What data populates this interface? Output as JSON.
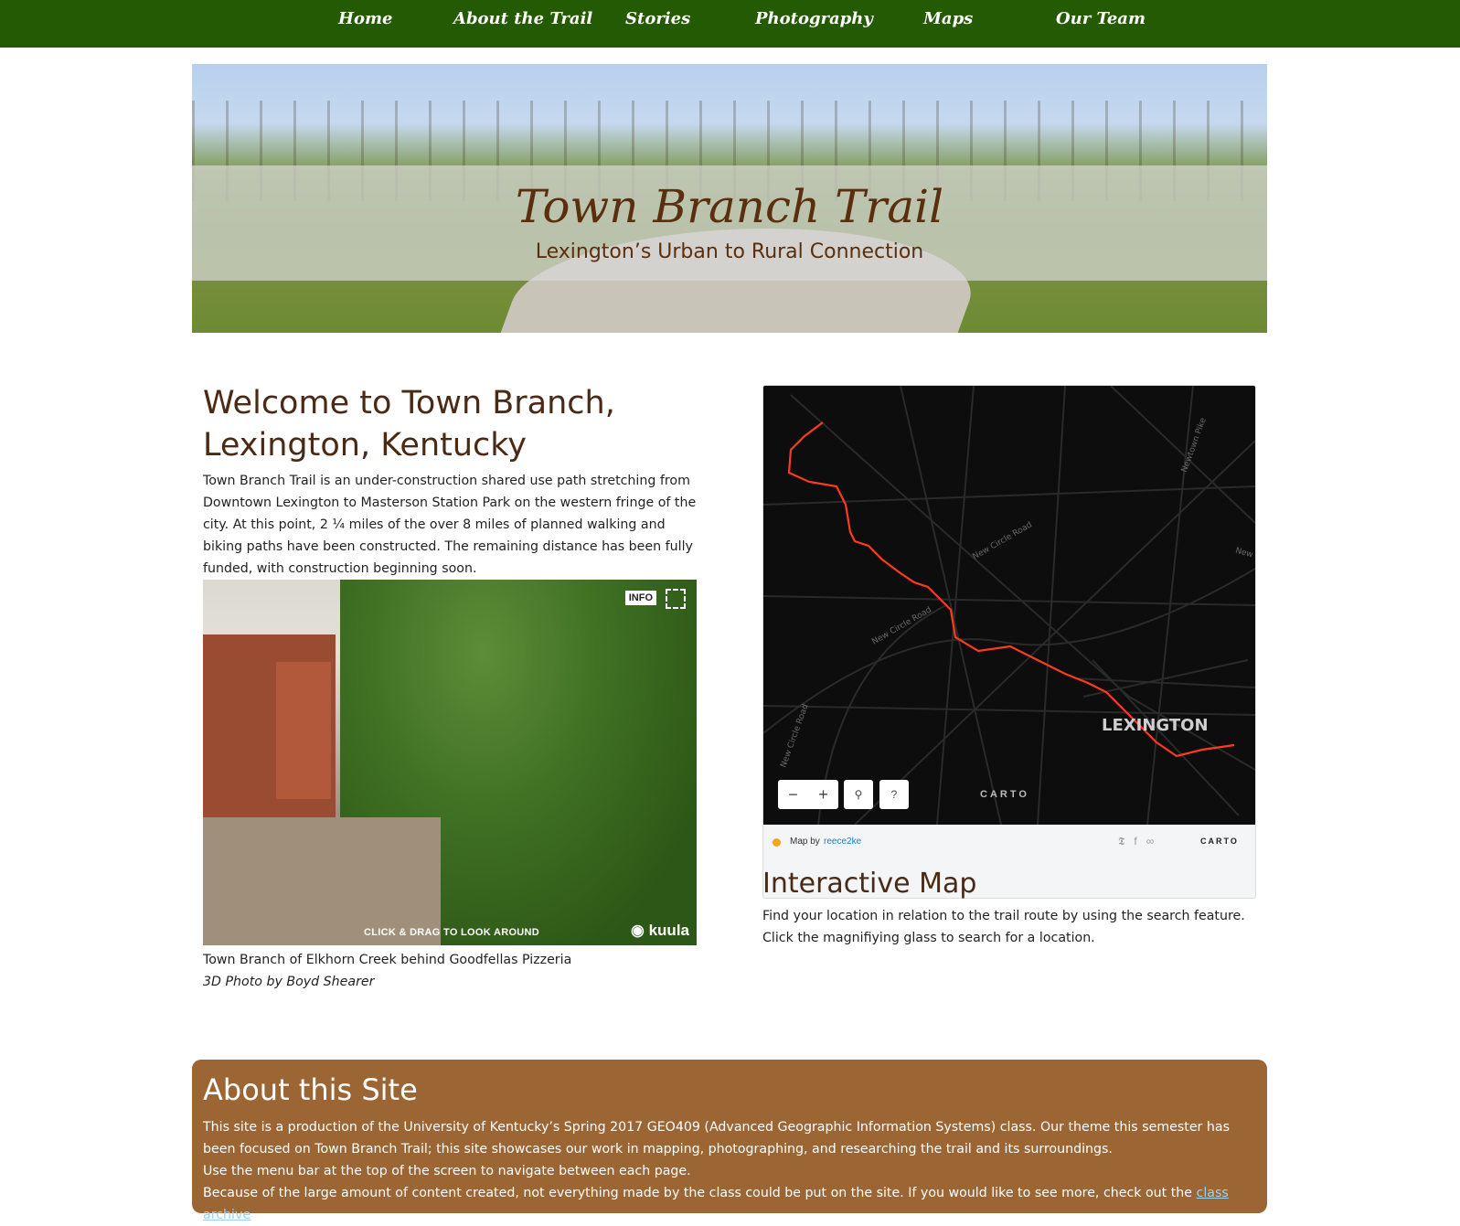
{
  "nav": {
    "items": [
      "Home",
      "About the Trail",
      "Stories",
      "Photography",
      "Maps",
      "Our Team"
    ]
  },
  "banner": {
    "title": "Town Branch Trail",
    "subtitle": "Lexington’s Urban to Rural Connection"
  },
  "welcome": {
    "title": "Welcome to Town Branch, Lexington, Kentucky",
    "body": "Town Branch Trail is an under-construction shared use path stretching from Downtown Lexington to Masterson Station Park on the western fringe of the city. At this point, 2 ¼ miles of the over 8 miles of planned walking and biking paths have been constructed. The remaining distance has been fully funded, with construction beginning soon."
  },
  "panorama": {
    "info_label": "INFO",
    "hint": "CLICK & DRAG TO LOOK AROUND",
    "brand": "kuula",
    "caption": "Town Branch of Elkhorn Creek behind Goodfellas Pizzeria",
    "credit": "3D Photo by Boyd Shearer",
    "icons": [
      "fullscreen-icon",
      "kuula-logo-icon"
    ]
  },
  "map": {
    "city_label": "LEXINGTON",
    "road_labels": [
      "New Circle Road",
      "New Circle Road",
      "New Circle Road",
      "Newtown Pike",
      "New"
    ],
    "zoom_out": "−",
    "zoom_in": "+",
    "search_icon": "magnifier-icon",
    "help": "?",
    "watermark": "CARTO",
    "footer_prefix": "Map by",
    "footer_user": "reece2ke",
    "footer_logo": "CARTO",
    "share_icons": [
      "twitter-icon",
      "facebook-icon",
      "link-icon"
    ],
    "trail_color": "#ff3b1f"
  },
  "interactive": {
    "title": "Interactive Map",
    "body": "Find your location in relation to the trail route by using the search feature. Click the magnifiying glass to search for a location."
  },
  "about": {
    "title": "About this Site",
    "p1": "This site is a production of the University of Kentucky’s Spring 2017 GEO409 (Advanced Geographic Information Systems) class. Our theme this semester has been focused on Town Branch Trail; this site showcases our work in mapping, photographing, and researching the trail and its surroundings.",
    "p2": "Use the menu bar at the top of the screen to navigate between each page.",
    "p3_prefix": "Because of the large amount of content created, not everything made by the class could be put on the site. If you would like to see more, check out the ",
    "p3_link": "class archive",
    "p3_suffix": "."
  },
  "colors": {
    "nav_bg": "#245a04",
    "heading": "#4a2a15",
    "about_bg": "#9b6633",
    "link": "#9ad2f5"
  }
}
